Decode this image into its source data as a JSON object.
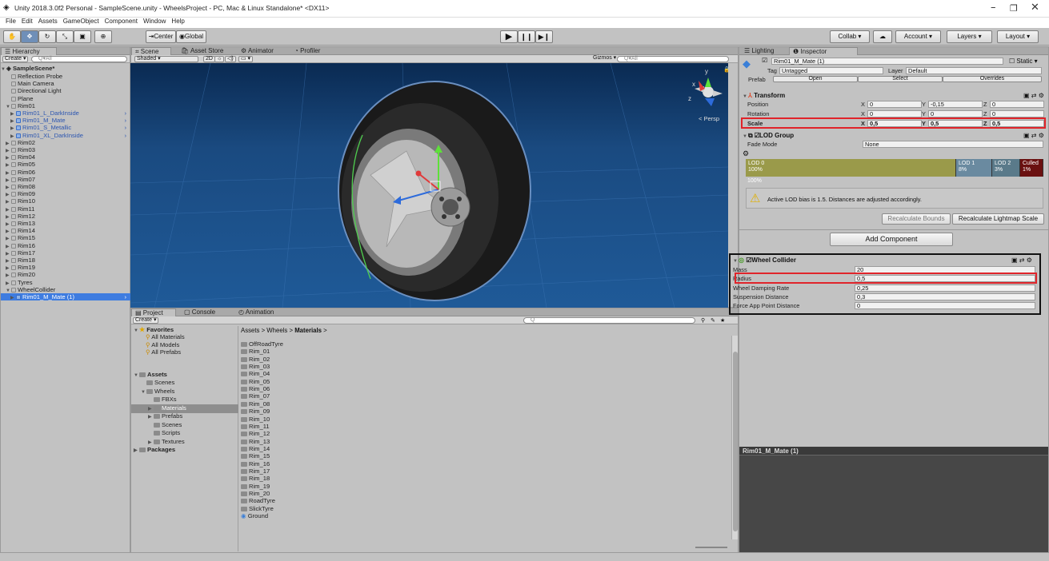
{
  "window": {
    "title": "Unity 2018.3.0f2 Personal - SampleScene.unity - WheelsProject - PC, Mac & Linux Standalone* <DX11>",
    "minimize": "–",
    "maximize": "❐",
    "close": "✕"
  },
  "menu": [
    "File",
    "Edit",
    "Assets",
    "GameObject",
    "Component",
    "Window",
    "Help"
  ],
  "toolbar": {
    "center": "Center",
    "global": "Global",
    "collab": "Collab ▾",
    "account": "Account",
    "layers": "Layers",
    "layout": "Layout"
  },
  "hierarchy": {
    "tab": "Hierarchy",
    "create": "Create ▾",
    "search_placeholder": "All",
    "scene": "SampleScene*",
    "items": [
      {
        "label": "Reflection Probe",
        "indent": 1,
        "fold": ""
      },
      {
        "label": "Main Camera",
        "indent": 1,
        "fold": ""
      },
      {
        "label": "Directional Light",
        "indent": 1,
        "fold": ""
      },
      {
        "label": "Plane",
        "indent": 1,
        "fold": ""
      },
      {
        "label": "Rim01",
        "indent": 1,
        "fold": "▼"
      },
      {
        "label": "Rim01_L_DarkInside",
        "indent": 2,
        "fold": "▶",
        "prefab": true
      },
      {
        "label": "Rim01_M_Mate",
        "indent": 2,
        "fold": "▶",
        "prefab": true
      },
      {
        "label": "Rim01_S_Metallic",
        "indent": 2,
        "fold": "▶",
        "prefab": true
      },
      {
        "label": "Rim01_XL_DarkInside",
        "indent": 2,
        "fold": "▶",
        "prefab": true
      },
      {
        "label": "Rim02",
        "indent": 1,
        "fold": "▶"
      },
      {
        "label": "Rim03",
        "indent": 1,
        "fold": "▶"
      },
      {
        "label": "Rim04",
        "indent": 1,
        "fold": "▶"
      },
      {
        "label": "Rim05",
        "indent": 1,
        "fold": "▶"
      },
      {
        "label": "Rim06",
        "indent": 1,
        "fold": "▶"
      },
      {
        "label": "Rim07",
        "indent": 1,
        "fold": "▶"
      },
      {
        "label": "Rim08",
        "indent": 1,
        "fold": "▶"
      },
      {
        "label": "Rim09",
        "indent": 1,
        "fold": "▶"
      },
      {
        "label": "Rim10",
        "indent": 1,
        "fold": "▶"
      },
      {
        "label": "Rim11",
        "indent": 1,
        "fold": "▶"
      },
      {
        "label": "Rim12",
        "indent": 1,
        "fold": "▶"
      },
      {
        "label": "Rim13",
        "indent": 1,
        "fold": "▶"
      },
      {
        "label": "Rim14",
        "indent": 1,
        "fold": "▶"
      },
      {
        "label": "Rim15",
        "indent": 1,
        "fold": "▶"
      },
      {
        "label": "Rim16",
        "indent": 1,
        "fold": "▶"
      },
      {
        "label": "Rim17",
        "indent": 1,
        "fold": "▶"
      },
      {
        "label": "Rim18",
        "indent": 1,
        "fold": "▶"
      },
      {
        "label": "Rim19",
        "indent": 1,
        "fold": "▶"
      },
      {
        "label": "Rim20",
        "indent": 1,
        "fold": "▶"
      },
      {
        "label": "Tyres",
        "indent": 1,
        "fold": "▶"
      },
      {
        "label": "WheelCollider",
        "indent": 1,
        "fold": "▼"
      },
      {
        "label": "Rim01_M_Mate (1)",
        "indent": 2,
        "fold": "▶",
        "prefab": true,
        "selected": true
      }
    ]
  },
  "scene": {
    "tabs": [
      "Scene",
      "Asset Store",
      "Animator",
      "Profiler"
    ],
    "shaded": "Shaded",
    "mode2d": "2D",
    "gizmos": "Gizmos ▾",
    "search_placeholder": "All",
    "persp": "< Persp",
    "axes": {
      "x": "x",
      "y": "y",
      "z": "z"
    }
  },
  "project": {
    "tabs": [
      "Project",
      "Console",
      "Animation"
    ],
    "create": "Create ▾",
    "favorites": {
      "label": "Favorites",
      "items": [
        "All Materials",
        "All Models",
        "All Prefabs"
      ]
    },
    "assets": {
      "label": "Assets",
      "items": [
        {
          "label": "Scenes",
          "indent": 1,
          "fold": ""
        },
        {
          "label": "Wheels",
          "indent": 1,
          "fold": "▼"
        },
        {
          "label": "FBXs",
          "indent": 2,
          "fold": ""
        },
        {
          "label": "Materials",
          "indent": 2,
          "fold": "▶",
          "selected": true
        },
        {
          "label": "Prefabs",
          "indent": 2,
          "fold": "▶"
        },
        {
          "label": "Scenes",
          "indent": 2,
          "fold": ""
        },
        {
          "label": "Scripts",
          "indent": 2,
          "fold": ""
        },
        {
          "label": "Textures",
          "indent": 2,
          "fold": "▶"
        }
      ]
    },
    "packages": "Packages",
    "breadcrumb": [
      "Assets",
      "Wheels",
      "Materials"
    ],
    "files": [
      "OffRoadTyre",
      "Rim_01",
      "Rim_02",
      "Rim_03",
      "Rim_04",
      "Rim_05",
      "Rim_06",
      "Rim_07",
      "Rim_08",
      "Rim_09",
      "Rim_10",
      "Rim_11",
      "Rim_12",
      "Rim_13",
      "Rim_14",
      "Rim_15",
      "Rim_16",
      "Rim_17",
      "Rim_18",
      "Rim_19",
      "Rim_20",
      "RoadTyre",
      "SlickTyre",
      "Ground"
    ]
  },
  "inspector": {
    "tabs": [
      "Lighting",
      "Inspector"
    ],
    "object_name": "Rim01_M_Mate (1)",
    "static": "Static ▾",
    "tag_label": "Tag",
    "tag_value": "Untagged",
    "layer_label": "Layer",
    "layer_value": "Default",
    "prefab_label": "Prefab",
    "prefab_buttons": [
      "Open",
      "Select",
      "Overrides"
    ],
    "transform": {
      "title": "Transform",
      "position": {
        "label": "Position",
        "x": "0",
        "y": "-0,15",
        "z": "0"
      },
      "rotation": {
        "label": "Rotation",
        "x": "0",
        "y": "0",
        "z": "0"
      },
      "scale": {
        "label": "Scale",
        "x": "0,5",
        "y": "0,5",
        "z": "0,5"
      }
    },
    "lod": {
      "title": "LOD Group",
      "fade_label": "Fade Mode",
      "fade_value": "None",
      "lod0_name": "LOD 0",
      "lod0_pct": "100%",
      "lod1_name": "LOD 1",
      "lod1_pct": "8%",
      "lod2_name": "LOD 2",
      "lod2_pct": "3%",
      "culled_name": "Culled",
      "culled_pct": "1%",
      "pct_below": "100%",
      "warning": "Active LOD bias is 1.5. Distances are adjusted accordingly.",
      "recalc_bounds": "Recalculate Bounds",
      "recalc_lightmap": "Recalculate Lightmap Scale"
    },
    "add_component": "Add Component",
    "wheel_collider": {
      "title": "Wheel Collider",
      "rows": [
        {
          "label": "Mass",
          "value": "20"
        },
        {
          "label": "Radius",
          "value": "0,5"
        },
        {
          "label": "Wheel Damping Rate",
          "value": "0,25"
        },
        {
          "label": "Suspension Distance",
          "value": "0,3"
        },
        {
          "label": "Force App Point Distance",
          "value": "0"
        }
      ]
    },
    "preview_title": "Rim01_M_Mate (1)"
  },
  "colors": {
    "selection": "#3e7ce0",
    "highlight": "#e0242a",
    "lod0": "#9a9a4a",
    "lod1": "#6a8aa0",
    "lod2": "#5a7a8a",
    "culled": "#6a1010"
  }
}
